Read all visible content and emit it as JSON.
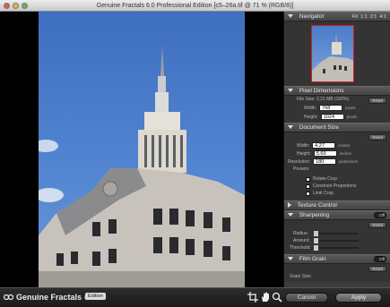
{
  "window": {
    "title": "Genuine Fractals 6.0 Professional Edition [c5–26a.tif @ 71 % (RGB/8)]"
  },
  "navigator": {
    "title": "Navigator",
    "zoom_fit": "Fit",
    "zoom_1": "1:1",
    "zoom_2": "2:1",
    "zoom_4": "4:1"
  },
  "pixel_dimensions": {
    "title": "Pixel Dimensions",
    "reset": "Reset",
    "file_size": "File Size: 2.21 MB (100%)",
    "width_label": "Width:",
    "width_value": "768",
    "width_unit": "pixels",
    "height_label": "Height:",
    "height_value": "1024",
    "height_unit": "pixels"
  },
  "document_size": {
    "title": "Document Size",
    "reset": "Reset",
    "width_label": "Width:",
    "width_value": "4.27",
    "width_unit": "inches",
    "height_label": "Height:",
    "height_value": "5.69",
    "height_unit": "inches",
    "resolution_label": "Resolution:",
    "resolution_value": "180",
    "resolution_unit": "pixels/inch",
    "presets_label": "Presets:",
    "rotate_crop": "Rotate Crop",
    "constrain": "Constrain Proportions",
    "limit_crop": "Limit Crop"
  },
  "texture_control": {
    "title": "Texture Control"
  },
  "sharpening": {
    "title": "Sharpening",
    "toggle": "Off",
    "reset": "Reset",
    "radius_label": "Radius:",
    "amount_label": "Amount:",
    "threshold_label": "Threshold:"
  },
  "film_grain": {
    "title": "Film Grain",
    "toggle": "Off",
    "reset": "Reset",
    "size_label": "Grain Size:"
  },
  "bottombar": {
    "brand": "Genuine Fractals",
    "version": "6",
    "edition": "Edition",
    "cancel": "Cancel",
    "apply": "Apply"
  }
}
